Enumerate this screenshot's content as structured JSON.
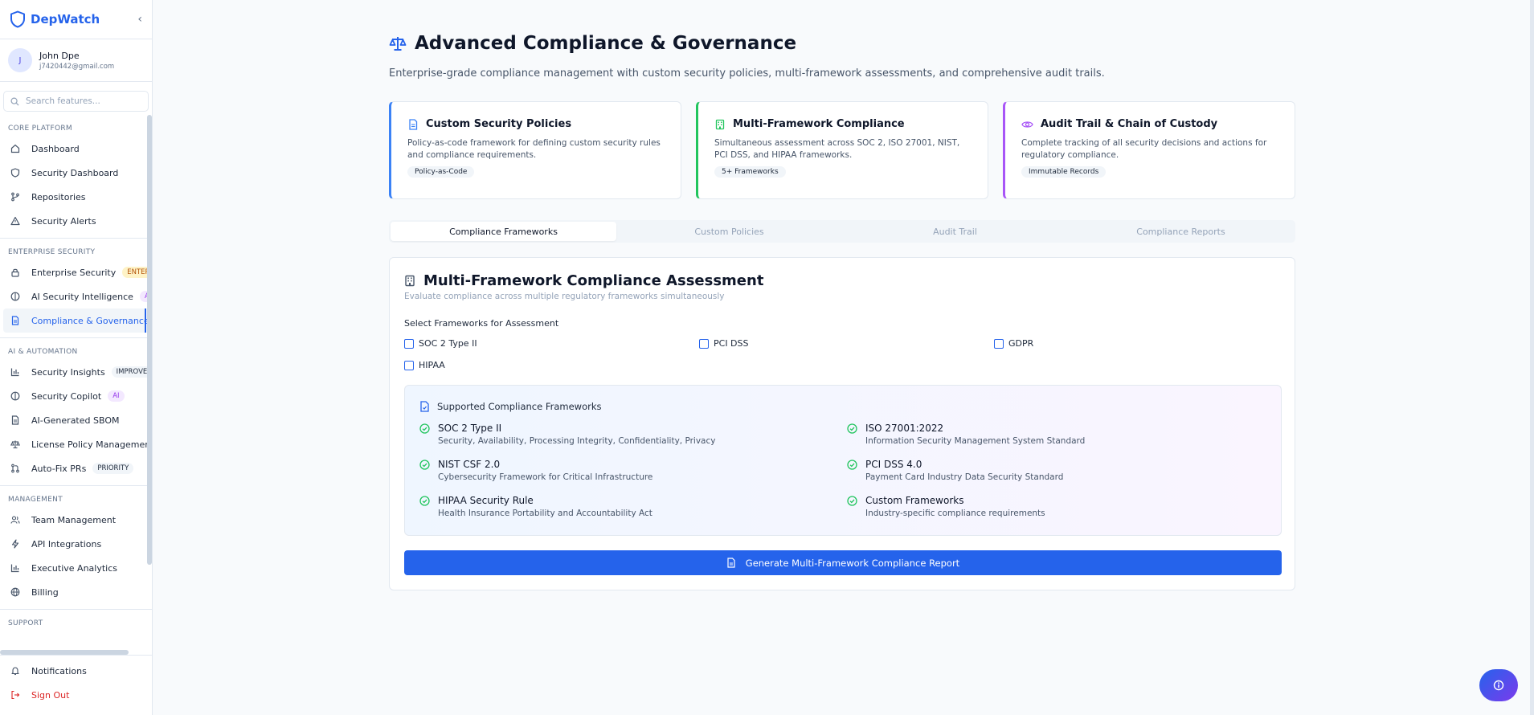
{
  "brand": {
    "name": "DepWatch",
    "collapse_glyph": "‹"
  },
  "user": {
    "initial": "J",
    "name": "John Dpe",
    "email": "j7420442@gmail.com"
  },
  "search": {
    "placeholder": "Search features..."
  },
  "sections": {
    "core": "CORE PLATFORM",
    "enterprise": "ENTERPRISE SECURITY",
    "ai": "AI & AUTOMATION",
    "management": "MANAGEMENT",
    "support": "SUPPORT"
  },
  "nav": {
    "dashboard": "Dashboard",
    "security_dashboard": "Security Dashboard",
    "repositories": "Repositories",
    "security_alerts": "Security Alerts",
    "enterprise_security": "Enterprise Security",
    "enterprise_badge": "ENTERPRISE",
    "ai_intel": "AI Security Intelligence",
    "ai_badge": "AI",
    "compliance": "Compliance & Governance",
    "security_insights": "Security Insights",
    "improved_badge": "IMPROVED",
    "copilot": "Security Copilot",
    "copilot_badge": "AI",
    "sbom": "AI-Generated SBOM",
    "license": "License Policy Management",
    "autofix": "Auto-Fix PRs",
    "priority_badge": "PRIORITY",
    "team": "Team Management",
    "api": "API Integrations",
    "analytics": "Executive Analytics",
    "billing": "Billing",
    "notifications": "Notifications",
    "sign_out": "Sign Out"
  },
  "page": {
    "title": "Advanced Compliance & Governance",
    "subtitle": "Enterprise-grade compliance management with custom security policies, multi-framework assessments, and comprehensive audit trails."
  },
  "cards": [
    {
      "title": "Custom Security Policies",
      "desc": "Policy-as-code framework for defining custom security rules and compliance requirements.",
      "pill": "Policy-as-Code",
      "accent": "#3b82f6",
      "icon": "document-icon"
    },
    {
      "title": "Multi-Framework Compliance",
      "desc": "Simultaneous assessment across SOC 2, ISO 27001, NIST, PCI DSS, and HIPAA frameworks.",
      "pill": "5+ Frameworks",
      "accent": "#22c55e",
      "icon": "building-icon"
    },
    {
      "title": "Audit Trail & Chain of Custody",
      "desc": "Complete tracking of all security decisions and actions for regulatory compliance.",
      "pill": "Immutable Records",
      "accent": "#a855f7",
      "icon": "eye-icon"
    }
  ],
  "tabs": [
    "Compliance Frameworks",
    "Custom Policies",
    "Audit Trail",
    "Compliance Reports"
  ],
  "panel": {
    "title": "Multi-Framework Compliance Assessment",
    "subtitle": "Evaluate compliance across multiple regulatory frameworks simultaneously",
    "select_label": "Select Frameworks for Assessment",
    "checkboxes": [
      "SOC 2 Type II",
      "PCI DSS",
      "GDPR",
      "HIPAA"
    ],
    "supported_title": "Supported Compliance Frameworks",
    "frameworks": [
      {
        "name": "SOC 2 Type II",
        "desc": "Security, Availability, Processing Integrity, Confidentiality, Privacy"
      },
      {
        "name": "ISO 27001:2022",
        "desc": "Information Security Management System Standard"
      },
      {
        "name": "NIST CSF 2.0",
        "desc": "Cybersecurity Framework for Critical Infrastructure"
      },
      {
        "name": "PCI DSS 4.0",
        "desc": "Payment Card Industry Data Security Standard"
      },
      {
        "name": "HIPAA Security Rule",
        "desc": "Health Insurance Portability and Accountability Act"
      },
      {
        "name": "Custom Frameworks",
        "desc": "Industry-specific compliance requirements"
      }
    ],
    "generate_label": "Generate Multi-Framework Compliance Report"
  },
  "colors": {
    "primary": "#2563eb",
    "success": "#22c55e",
    "accent_purple": "#a855f7",
    "danger": "#dc2626"
  }
}
